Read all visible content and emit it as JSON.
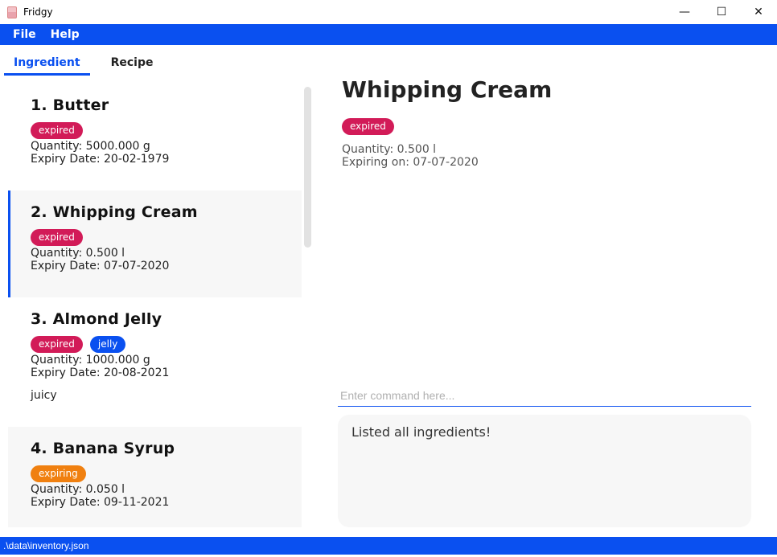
{
  "window": {
    "title": "Fridgy",
    "minimize": "—",
    "maximize": "☐",
    "close": "✕"
  },
  "menu": {
    "file": "File",
    "help": "Help"
  },
  "tabs": {
    "ingredient": "Ingredient",
    "recipe": "Recipe"
  },
  "ingredients": [
    {
      "name": "1.  Butter",
      "tags": [
        "expired"
      ],
      "quantity": "Quantity: 5000.000 g",
      "expiry": "Expiry Date: 20-02-1979"
    },
    {
      "name": "2.  Whipping Cream",
      "tags": [
        "expired"
      ],
      "quantity": "Quantity: 0.500 l",
      "expiry": "Expiry Date: 07-07-2020"
    },
    {
      "name": "3.  Almond Jelly",
      "tags": [
        "expired",
        "jelly"
      ],
      "quantity": "Quantity: 1000.000 g",
      "expiry": "Expiry Date: 20-08-2021",
      "note": "juicy"
    },
    {
      "name": "4.  Banana Syrup",
      "tags": [
        "expiring"
      ],
      "quantity": "Quantity: 0.050 l",
      "expiry": "Expiry Date: 09-11-2021"
    }
  ],
  "detail": {
    "title": "Whipping Cream",
    "tag": "expired",
    "quantity": "Quantity: 0.500 l",
    "expiring": "Expiring on: 07-07-2020"
  },
  "command": {
    "placeholder": "Enter command here..."
  },
  "result": {
    "text": "Listed all ingredients!"
  },
  "status": {
    "path": ".\\data\\inventory.json"
  },
  "colors": {
    "accent": "#0a50f0",
    "expired": "#d21b58",
    "expiring": "#f08010"
  }
}
